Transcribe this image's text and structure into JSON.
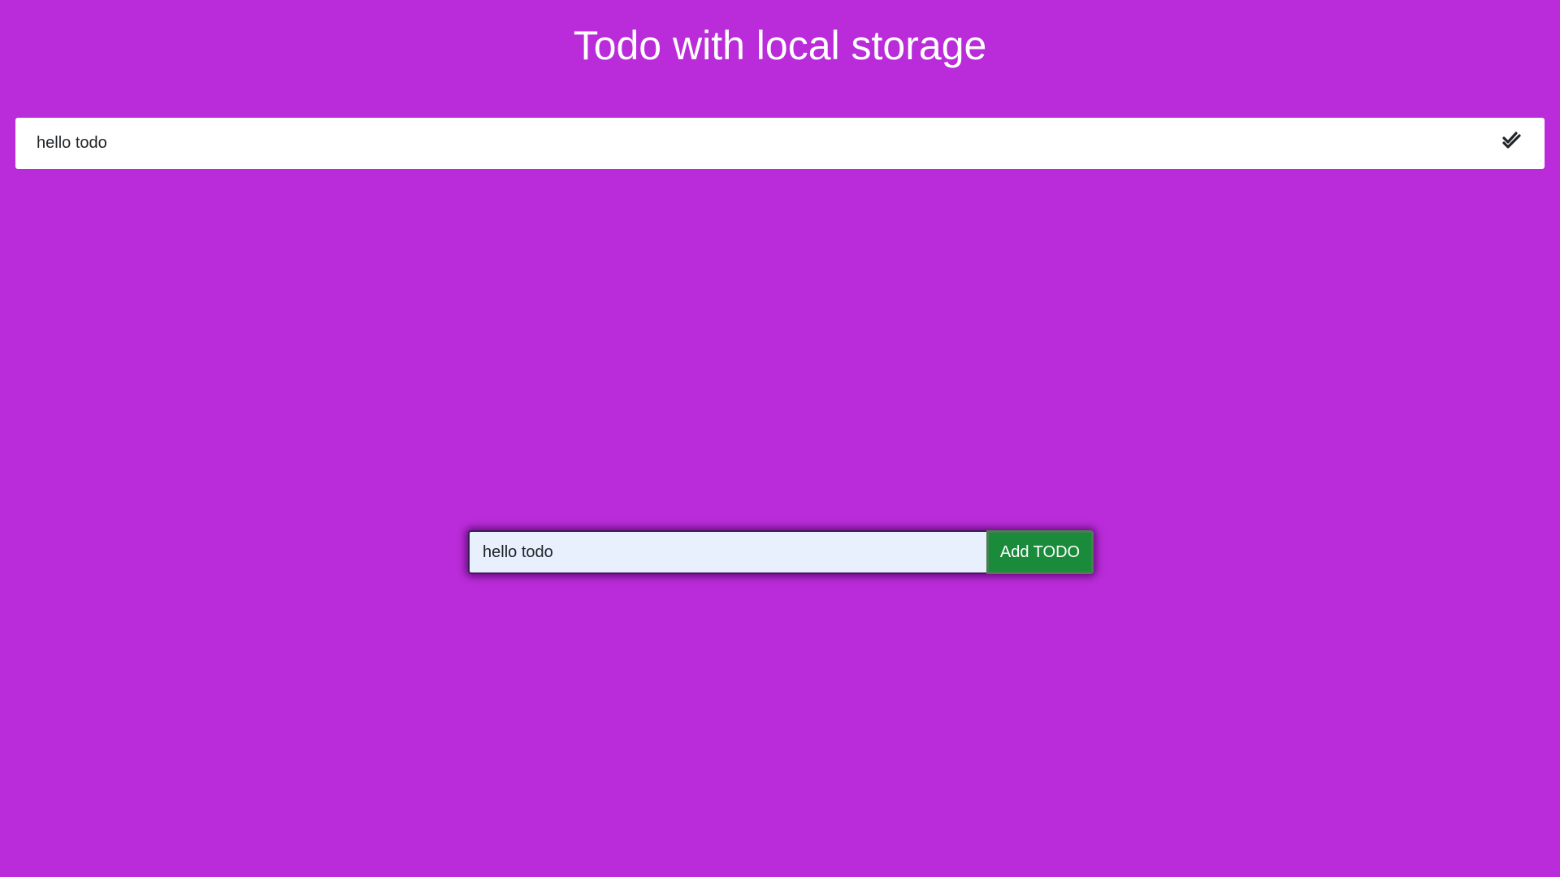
{
  "header": {
    "title": "Todo with local storage"
  },
  "todos": [
    {
      "text": "hello todo",
      "icon": "double-check-icon"
    }
  ],
  "form": {
    "input_value": "hello todo",
    "add_label": "Add TODO"
  },
  "colors": {
    "background": "#ba2cd9",
    "add_button": "#198b3a",
    "input_background": "#e8f0fe"
  }
}
